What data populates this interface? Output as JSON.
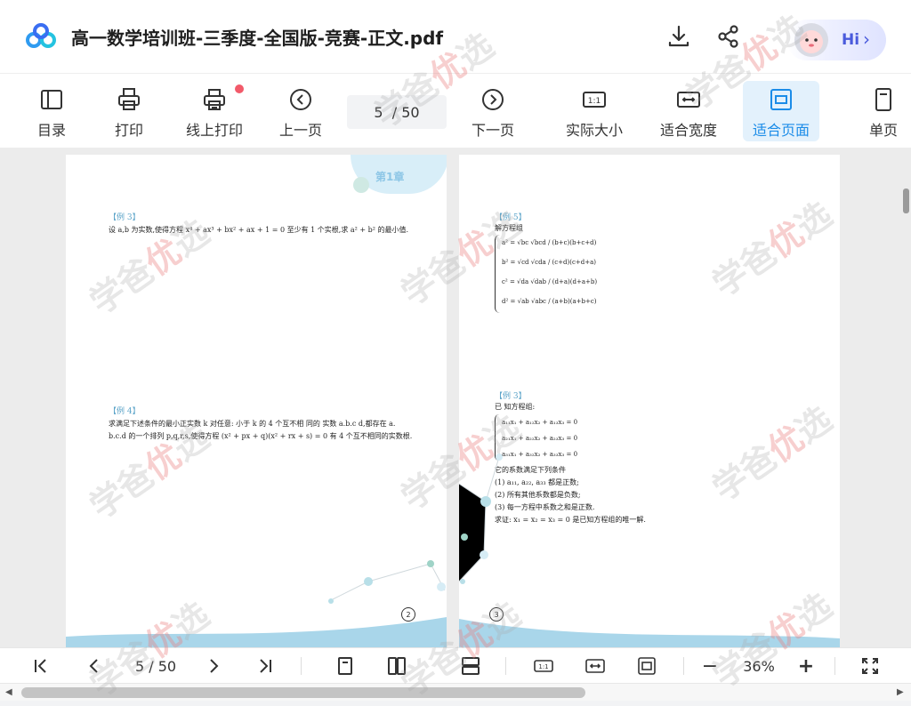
{
  "header": {
    "title": "高一数学培训班-三季度-全国版-竞赛-正文.pdf",
    "hi_label": "Hi",
    "hi_chevron": "›"
  },
  "toolbar": {
    "items": [
      {
        "label": "目录",
        "icon": "toc-icon"
      },
      {
        "label": "打印",
        "icon": "printer-icon"
      },
      {
        "label": "线上打印",
        "icon": "online-print-icon"
      },
      {
        "label": "上一页",
        "icon": "prev-page-icon"
      },
      {
        "label": "下一页",
        "icon": "next-page-icon"
      },
      {
        "label": "实际大小",
        "icon": "actual-size-icon"
      },
      {
        "label": "适合宽度",
        "icon": "fit-width-icon"
      },
      {
        "label": "适合页面",
        "icon": "fit-page-icon"
      },
      {
        "label": "单页",
        "icon": "single-page-icon"
      }
    ],
    "current_page": "5",
    "total_pages": "/ 50"
  },
  "pages": {
    "left": {
      "chapter": "第1章",
      "ex3_label": "【例 3】",
      "ex3_text": "设 a,b 为实数,使得方程 x⁴ + ax³ + bx² + ax + 1 = 0 至少有 1 个实根,求 a² + b² 的最小值.",
      "ex4_label": "【例 4】",
      "ex4_line1": "求满足下述条件的最小正实数 k 对任意: 小于 k 的 4 个互不相 同的 实数 a.b.c d,都存在 a.",
      "ex4_line2": "b.c.d 的一个排列 p,q,r,s,使得方程 (x² + px + q)(x² + rx + s) = 0 有 4 个互不相同的实数根.",
      "page_number": "2"
    },
    "right": {
      "ex5_label": "【例 5】",
      "ex5_intro": "解方程组",
      "ex5_eq1": "a² = √bc √bcd / (b+c)(b+c+d)",
      "ex5_eq2": "b² = √cd √cda / (c+d)(c+d+a)",
      "ex5_eq3": "c² = √da √dab / (d+a)(d+a+b)",
      "ex5_eq4": "d² = √ab √abc / (a+b)(a+b+c)",
      "ex6_label": "【例 3】",
      "ex6_intro": "已 知方程组:",
      "ex6_eq1": "a₁₁x₁ + a₁₂x₂ + a₁₃x₃ = 0",
      "ex6_eq2": "a₂₁x₁ + a₂₂x₂ + a₂₃x₃ = 0",
      "ex6_eq3": "a₃₁x₁ + a₃₂x₂ + a₃₃x₃ = 0",
      "ex6_cond": "它的系数满足下列条件",
      "ex6_c1": "(1) a₁₁, a₂₂, a₃₃ 都是正数;",
      "ex6_c2": "(2) 所有其他系数都是负数;",
      "ex6_c3": "(3) 每一方程中系数之和是正数.",
      "ex6_goal": "求证: x₁ = x₂ = x₃ = 0 是已知方程组的唯一解.",
      "page_number": "3"
    }
  },
  "bottom": {
    "page_current": "5",
    "page_total": "/ 50",
    "zoom": "36%",
    "minus": "−",
    "plus": "+"
  },
  "watermark": {
    "text_a": "学爸",
    "text_b": "优",
    "text_c": "选"
  },
  "colors": {
    "accent": "#1b8ce8",
    "active_bg": "#e3f1fc",
    "badge": "#f25a6a"
  }
}
